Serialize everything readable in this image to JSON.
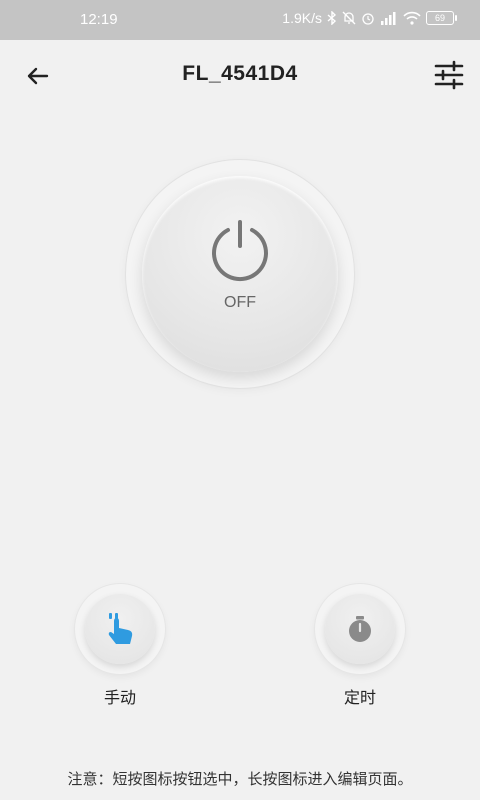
{
  "status_bar": {
    "time": "12:19",
    "net_speed": "1.9K/s",
    "battery": "69"
  },
  "header": {
    "title": "FL_4541D4"
  },
  "power": {
    "state_label": "OFF"
  },
  "modes": [
    {
      "label": "手动",
      "icon": "hand-tap-icon",
      "color": "#2f9be0"
    },
    {
      "label": "定时",
      "icon": "stopwatch-icon",
      "color": "#8a8a8a"
    }
  ],
  "note": "注意：短按图标按钮选中，长按图标进入编辑页面。"
}
